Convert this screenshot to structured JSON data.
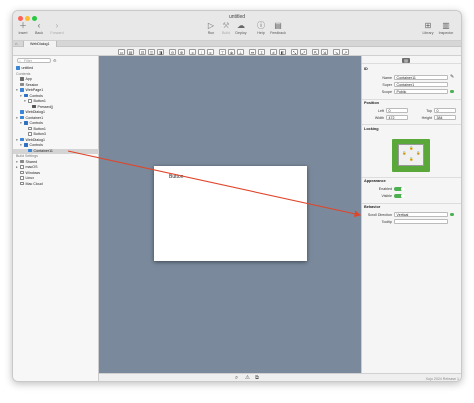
{
  "window": {
    "title": "untitled",
    "toolbar": {
      "insert": "Insert",
      "back": "Back",
      "forward": "Forward",
      "run": "Run",
      "build": "Build",
      "deploy": "Deploy",
      "help": "Help",
      "feedback": "Feedback",
      "library": "Library",
      "inspector": "Inspector"
    },
    "tab_label": "WebDialog1"
  },
  "navigator": {
    "filter_placeholder": "Filter",
    "items": [
      {
        "label": "untitled",
        "icon": "project-icon"
      },
      {
        "label": "Contents",
        "icon": ""
      },
      {
        "label": "App",
        "icon": "app-icon"
      },
      {
        "label": "Session",
        "icon": "session-icon"
      },
      {
        "label": "WebPage1",
        "icon": "webpage-icon"
      },
      {
        "label": "Controls",
        "icon": "controls-icon"
      },
      {
        "label": "Button1",
        "icon": "button-icon"
      },
      {
        "label": "Pressed()",
        "icon": "event-icon"
      },
      {
        "label": "WebDialog1",
        "icon": "webdialog-icon"
      },
      {
        "label": "Container1",
        "icon": "container-icon"
      },
      {
        "label": "Controls",
        "icon": "controls-icon"
      },
      {
        "label": "Button1",
        "icon": "button-icon"
      },
      {
        "label": "Button3",
        "icon": "button-icon"
      },
      {
        "label": "WebDialog1",
        "icon": "webdialog-icon"
      },
      {
        "label": "Controls",
        "icon": "controls-icon"
      },
      {
        "label": "Container11",
        "icon": "container-icon"
      },
      {
        "label": "Build Settings",
        "icon": ""
      },
      {
        "label": "Shared",
        "icon": "shared-icon"
      },
      {
        "label": "macOS",
        "icon": "checkbox-icon"
      },
      {
        "label": "Windows",
        "icon": "checkbox-icon"
      },
      {
        "label": "Linux",
        "icon": "checkbox-icon"
      },
      {
        "label": "Mac Cloud",
        "icon": "checkbox-icon"
      }
    ]
  },
  "canvas": {
    "button_label": "Button"
  },
  "statusbar": {
    "version": "Xojo 2024 Release 1"
  },
  "inspector": {
    "id_section": "ID",
    "name_label": "Name",
    "name_value": "Container11",
    "super_label": "Super",
    "super_value": "Container1",
    "scope_label": "Scope",
    "scope_value": "Public",
    "position_section": "Position",
    "left_label": "Left",
    "left_value": "0",
    "top_label": "Top",
    "top_value": "0",
    "width_label": "Width",
    "width_value": "472",
    "height_label": "Height",
    "height_value": "384",
    "locking_section": "Locking",
    "appearance_section": "Appearance",
    "enabled_label": "Enabled",
    "visible_label": "Visible",
    "behavior_section": "Behavior",
    "scroll_direction_label": "Scroll Direction",
    "scroll_direction_value": "Vertical",
    "tooltip_label": "Tooltip",
    "tooltip_value": ""
  },
  "colors": {
    "canvas": "#7a8a9c",
    "accent_green": "#4caf50",
    "arrow_red": "#e0452a",
    "selected_icon_blue": "#3a86d6"
  }
}
